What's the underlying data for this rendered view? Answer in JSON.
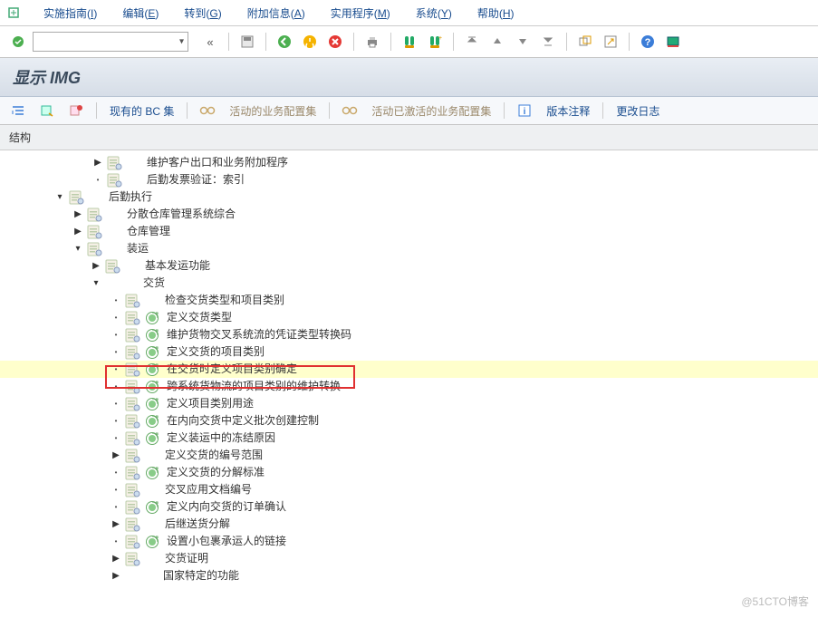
{
  "menu": {
    "items": [
      {
        "label": "实施指南",
        "accel": "I"
      },
      {
        "label": "编辑",
        "accel": "E"
      },
      {
        "label": "转到",
        "accel": "G"
      },
      {
        "label": "附加信息",
        "accel": "A"
      },
      {
        "label": "实用程序",
        "accel": "M"
      },
      {
        "label": "系统",
        "accel": "Y"
      },
      {
        "label": "帮助",
        "accel": "H"
      }
    ]
  },
  "toolbar": {
    "command_value": "",
    "back_glyph": "«"
  },
  "title": "显示 IMG",
  "subtoolbar": {
    "existing_bc": "现有的 BC 集",
    "active_bc": "活动的业务配置集",
    "active_activated_bc": "活动已激活的业务配置集",
    "version_notes": "版本注释",
    "change_log": "更改日志"
  },
  "struct_header": "结构",
  "tree": [
    {
      "indent": 100,
      "expander": "▶",
      "img": true,
      "exec": false,
      "label": "维护客户出口和业务附加程序"
    },
    {
      "indent": 100,
      "expander": "·",
      "img": true,
      "exec": false,
      "label": "后勤发票验证：索引"
    },
    {
      "indent": 58,
      "expander": "▾",
      "img": true,
      "exec": false,
      "label": "后勤执行"
    },
    {
      "indent": 78,
      "expander": "▶",
      "img": true,
      "exec": false,
      "label": "分散仓库管理系统综合"
    },
    {
      "indent": 78,
      "expander": "▶",
      "img": true,
      "exec": false,
      "label": "仓库管理"
    },
    {
      "indent": 78,
      "expander": "▾",
      "img": true,
      "exec": false,
      "label": "装运"
    },
    {
      "indent": 98,
      "expander": "▶",
      "img": true,
      "exec": false,
      "label": "基本发运功能"
    },
    {
      "indent": 98,
      "expander": "▾",
      "img": false,
      "exec": false,
      "label": "交货"
    },
    {
      "indent": 120,
      "expander": "·",
      "img": true,
      "exec": false,
      "label": "检查交货类型和项目类别"
    },
    {
      "indent": 120,
      "expander": "·",
      "img": true,
      "exec": true,
      "label": "定义交货类型"
    },
    {
      "indent": 120,
      "expander": "·",
      "img": true,
      "exec": true,
      "label": "维护货物交叉系统流的凭证类型转换码"
    },
    {
      "indent": 120,
      "expander": "·",
      "img": true,
      "exec": true,
      "label": "定义交货的项目类别"
    },
    {
      "indent": 120,
      "expander": "·",
      "img": true,
      "exec": true,
      "label": "在交货时定义项目类别确定",
      "selected": true
    },
    {
      "indent": 120,
      "expander": "·",
      "img": true,
      "exec": true,
      "label": "跨系统货物流的项目类别的维护转换"
    },
    {
      "indent": 120,
      "expander": "·",
      "img": true,
      "exec": true,
      "label": "定义项目类别用途"
    },
    {
      "indent": 120,
      "expander": "·",
      "img": true,
      "exec": true,
      "label": "在内向交货中定义批次创建控制"
    },
    {
      "indent": 120,
      "expander": "·",
      "img": true,
      "exec": true,
      "label": "定义装运中的冻结原因"
    },
    {
      "indent": 120,
      "expander": "▶",
      "img": true,
      "exec": false,
      "label": "定义交货的编号范围"
    },
    {
      "indent": 120,
      "expander": "·",
      "img": true,
      "exec": true,
      "label": "定义交货的分解标准"
    },
    {
      "indent": 120,
      "expander": "·",
      "img": true,
      "exec": false,
      "label": "交叉应用文档编号"
    },
    {
      "indent": 120,
      "expander": "·",
      "img": true,
      "exec": true,
      "label": "定义内向交货的订单确认"
    },
    {
      "indent": 120,
      "expander": "▶",
      "img": true,
      "exec": false,
      "label": "后继送货分解"
    },
    {
      "indent": 120,
      "expander": "·",
      "img": true,
      "exec": true,
      "label": "设置小包裹承运人的链接"
    },
    {
      "indent": 120,
      "expander": "▶",
      "img": true,
      "exec": false,
      "label": "交货证明"
    },
    {
      "indent": 120,
      "expander": "▶",
      "img": false,
      "exec": false,
      "label": "国家特定的功能"
    }
  ],
  "watermark": "@51CTO博客"
}
